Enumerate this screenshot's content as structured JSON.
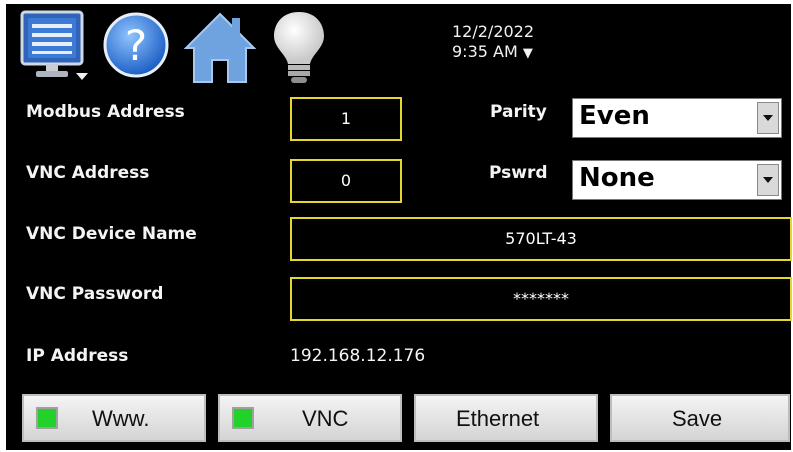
{
  "header": {
    "date": "12/2/2022",
    "time": "9:35 AM",
    "time_menu_glyph": "▼",
    "icons": [
      "monitor-menu-icon",
      "help-icon",
      "home-icon",
      "lightbulb-icon"
    ]
  },
  "form": {
    "modbus_address": {
      "label": "Modbus Address",
      "value": "1"
    },
    "vnc_address": {
      "label": "VNC Address",
      "value": "0"
    },
    "parity": {
      "label": "Parity",
      "value": "Even"
    },
    "password_mode": {
      "label": "Pswrd",
      "value": "None"
    },
    "vnc_device_name": {
      "label": "VNC Device Name",
      "value": "570LT-43"
    },
    "vnc_password": {
      "label": "VNC Password",
      "value": "*******"
    },
    "ip_address": {
      "label": "IP Address",
      "value": "192.168.12.176"
    }
  },
  "buttons": {
    "www": "Www.",
    "vnc": "VNC",
    "ethernet": "Ethernet",
    "save": "Save"
  },
  "colors": {
    "background": "#000000",
    "field_border": "#e6d72a",
    "led_on": "#22d12a"
  }
}
